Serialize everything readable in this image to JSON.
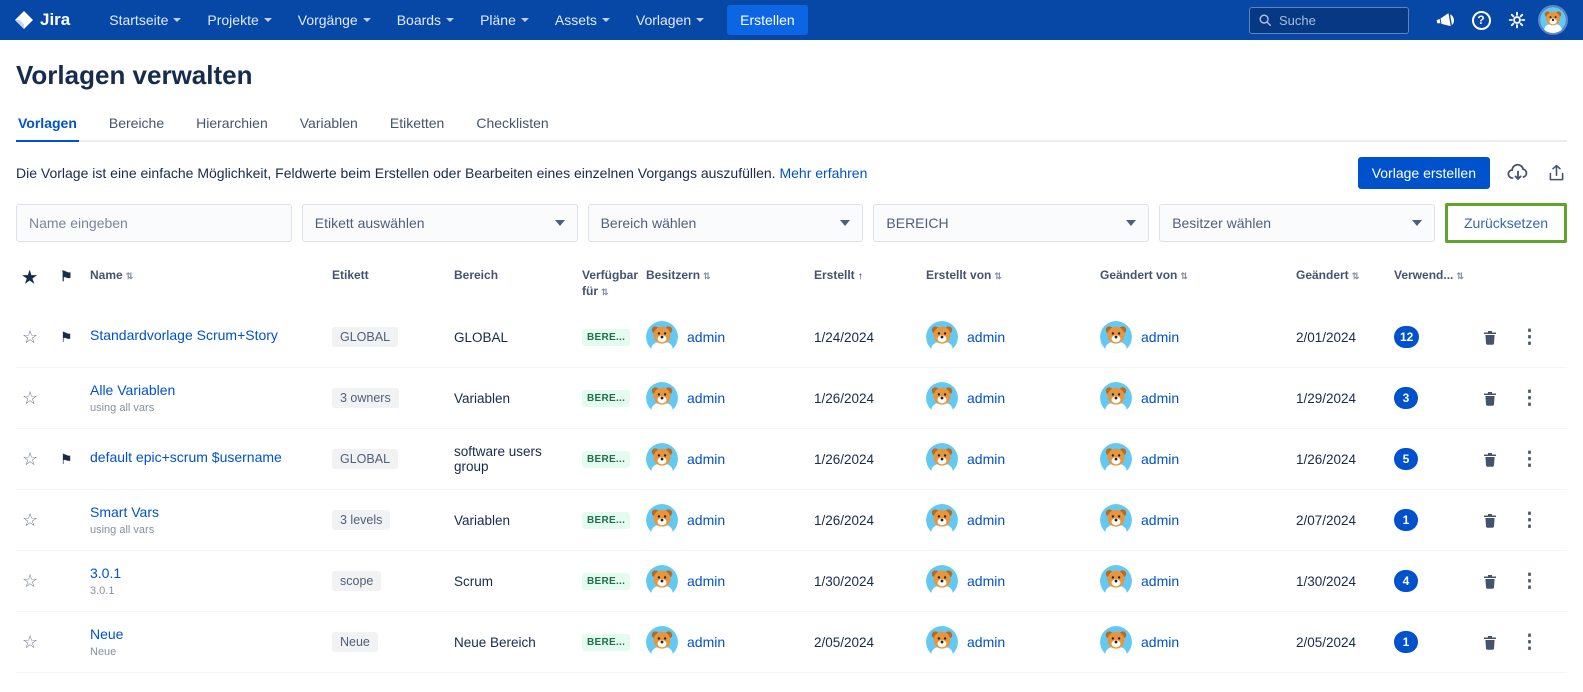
{
  "colors": {
    "header_bg": "#0747A6",
    "accent_blue": "#0052CC",
    "annotation_green": "#5FA32C",
    "availability_badge_bg": "#E3FCEF",
    "availability_badge_text": "#216E4E",
    "count_badge_bg": "#0052CC"
  },
  "header": {
    "logo_text": "Jira",
    "nav": [
      {
        "label": "Startseite"
      },
      {
        "label": "Projekte"
      },
      {
        "label": "Vorgänge"
      },
      {
        "label": "Boards"
      },
      {
        "label": "Pläne"
      },
      {
        "label": "Assets"
      },
      {
        "label": "Vorlagen"
      }
    ],
    "create_label": "Erstellen",
    "search_placeholder": "Suche"
  },
  "page": {
    "title": "Vorlagen verwalten",
    "tabs": [
      {
        "label": "Vorlagen"
      },
      {
        "label": "Bereiche"
      },
      {
        "label": "Hierarchien"
      },
      {
        "label": "Variablen"
      },
      {
        "label": "Etiketten"
      },
      {
        "label": "Checklisten"
      }
    ],
    "description": "Die Vorlage ist eine einfache Möglichkeit, Feldwerte beim Erstellen oder Bearbeiten eines einzelnen Vorgangs auszufüllen.",
    "learn_more_label": "Mehr erfahren",
    "create_button_label": "Vorlage erstellen"
  },
  "filters": {
    "name_placeholder": "Name eingeben",
    "selects": [
      {
        "value": "Etikett auswählen"
      },
      {
        "value": "Bereich wählen"
      },
      {
        "value": "BEREICH"
      },
      {
        "value": "Besitzer wählen"
      }
    ],
    "reset_label": "Zurücksetzen"
  },
  "table": {
    "columns": [
      "Name",
      "Etikett",
      "Bereich",
      "Verfügbar für",
      "Besitzern",
      "Erstellt",
      "Erstellt von",
      "Geändert von",
      "Geändert",
      "Verwend..."
    ],
    "rows": [
      {
        "name": "Standardvorlage Scrum+Story",
        "subtitle": "",
        "etikett": "GLOBAL",
        "bereich": "GLOBAL",
        "verfuegbar": "BERE...",
        "besitzer": "admin",
        "erstellt": "1/24/2024",
        "erstellt_von": "admin",
        "geaendert_von": "admin",
        "geaendert": "2/01/2024",
        "verwendet": "12"
      },
      {
        "name": "Alle Variablen",
        "subtitle": "using all vars",
        "etikett": "3 owners",
        "bereich": "Variablen",
        "verfuegbar": "BERE...",
        "besitzer": "admin",
        "erstellt": "1/26/2024",
        "erstellt_von": "admin",
        "geaendert_von": "admin",
        "geaendert": "1/29/2024",
        "verwendet": "3"
      },
      {
        "name": "default epic+scrum $username",
        "subtitle": "",
        "etikett": "GLOBAL",
        "bereich": "software users group",
        "verfuegbar": "BERE...",
        "besitzer": "admin",
        "erstellt": "1/26/2024",
        "erstellt_von": "admin",
        "geaendert_von": "admin",
        "geaendert": "1/26/2024",
        "verwendet": "5"
      },
      {
        "name": "Smart Vars",
        "subtitle": "using all vars",
        "etikett": "3 levels",
        "bereich": "Variablen",
        "verfuegbar": "BERE...",
        "besitzer": "admin",
        "erstellt": "1/26/2024",
        "erstellt_von": "admin",
        "geaendert_von": "admin",
        "geaendert": "2/07/2024",
        "verwendet": "1"
      },
      {
        "name": "3.0.1",
        "subtitle": "3.0.1",
        "etikett": "scope",
        "bereich": "Scrum",
        "verfuegbar": "BERE...",
        "besitzer": "admin",
        "erstellt": "1/30/2024",
        "erstellt_von": "admin",
        "geaendert_von": "admin",
        "geaendert": "1/30/2024",
        "verwendet": "4"
      },
      {
        "name": "Neue",
        "subtitle": "Neue",
        "etikett": "Neue",
        "bereich": "Neue Bereich",
        "verfuegbar": "BERE...",
        "besitzer": "admin",
        "erstellt": "2/05/2024",
        "erstellt_von": "admin",
        "geaendert_von": "admin",
        "geaendert": "2/05/2024",
        "verwendet": "1"
      }
    ]
  },
  "icons": {
    "star_filled": "★",
    "star_empty": "☆",
    "flag": "⚑",
    "dots": "⋮",
    "sort_both": "⇅",
    "sort_asc": "↑",
    "help": "?"
  }
}
